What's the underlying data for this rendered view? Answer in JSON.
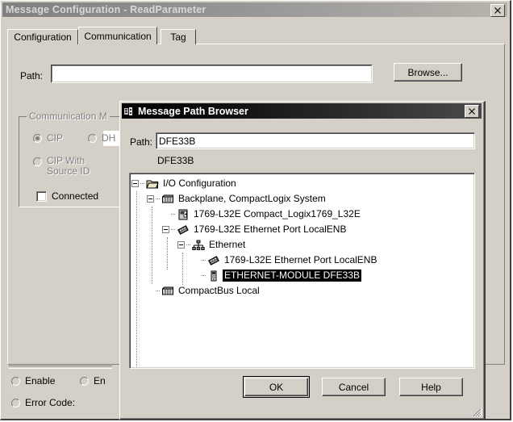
{
  "main_window": {
    "title": "Message Configuration - ReadParameter",
    "close_label": "✕",
    "tabs": [
      {
        "label": "Configuration",
        "active": false
      },
      {
        "label": "Communication",
        "active": true
      },
      {
        "label": "Tag",
        "active": false
      }
    ],
    "path_label": "Path:",
    "path_value": "",
    "path_placeholder": "",
    "browse_label": "Browse...",
    "comm_method": {
      "group_label": "Communication M",
      "options": [
        {
          "label": "CIP",
          "selected": true
        },
        {
          "label": "DH",
          "selected": false
        },
        {
          "label": "CIP With Source ID",
          "selected": false
        }
      ],
      "connected_label": "Connected",
      "connected_checked": false
    },
    "status": [
      {
        "label": "Enable",
        "lit": false
      },
      {
        "label": "En",
        "lit": false
      },
      {
        "label": "Error Code:",
        "lit": false
      }
    ]
  },
  "modal": {
    "title": "Message Path Browser",
    "close_label": "✕",
    "path_label": "Path:",
    "path_value": "DFE33B",
    "path_placeholder": "",
    "subpath_text": "DFE33B",
    "tree": [
      {
        "label": "I/O Configuration",
        "depth": 0,
        "icon": "folder-icon",
        "expander": "minus",
        "selected": false
      },
      {
        "label": "Backplane, CompactLogix System",
        "depth": 1,
        "icon": "chassis-icon",
        "expander": "minus",
        "selected": false
      },
      {
        "label": "1769-L32E Compact_Logix1769_L32E",
        "depth": 2,
        "icon": "controller-icon",
        "expander": "none",
        "selected": false
      },
      {
        "label": "1769-L32E Ethernet Port LocalENB",
        "depth": 2,
        "icon": "module-icon",
        "expander": "minus",
        "selected": false
      },
      {
        "label": "Ethernet",
        "depth": 3,
        "icon": "network-icon",
        "expander": "minus",
        "selected": false
      },
      {
        "label": "1769-L32E Ethernet Port LocalENB",
        "depth": 4,
        "icon": "module-icon",
        "expander": "none",
        "selected": false
      },
      {
        "label": "ETHERNET-MODULE DFE33B",
        "depth": 4,
        "icon": "device-icon",
        "expander": "none",
        "selected": true
      },
      {
        "label": "CompactBus Local",
        "depth": 1,
        "icon": "chassis-icon",
        "expander": "none",
        "selected": false
      }
    ],
    "buttons": {
      "ok": "OK",
      "cancel": "Cancel",
      "help": "Help"
    }
  },
  "colors": {
    "face": "#d4d0c8",
    "selection": "#000000",
    "selection_text": "#ffffff",
    "active_title": "#000000",
    "inactive_title": "#808080",
    "field": "#ffffff"
  }
}
